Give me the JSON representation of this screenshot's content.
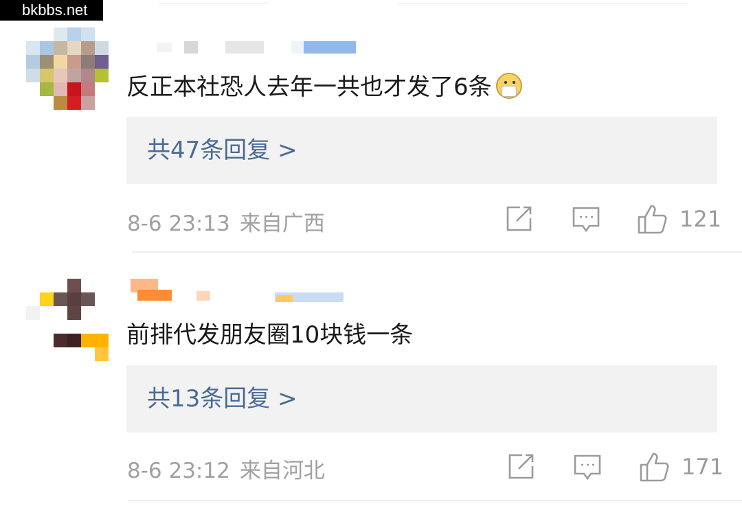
{
  "watermark": "bkbbs.net",
  "comments": [
    {
      "text": "反正本社恐人去年一共也才发了6条",
      "emoji_icon": "mask-face-icon",
      "replies_label": "共47条回复 >",
      "date": "8-6 23:13",
      "location": "来自广西",
      "likes": "121"
    },
    {
      "text": "前排代发朋友圈10块钱一条",
      "replies_label": "共13条回复 >",
      "date": "8-6 23:12",
      "location": "来自河北",
      "likes": "171"
    }
  ],
  "icons": {
    "share": "share-icon",
    "comment": "comment-icon",
    "like": "thumbs-up-icon"
  },
  "colors": {
    "reply_link": "#4a6b94",
    "meta_text": "#a0a0a0",
    "reply_box_bg": "#f2f2f2"
  }
}
